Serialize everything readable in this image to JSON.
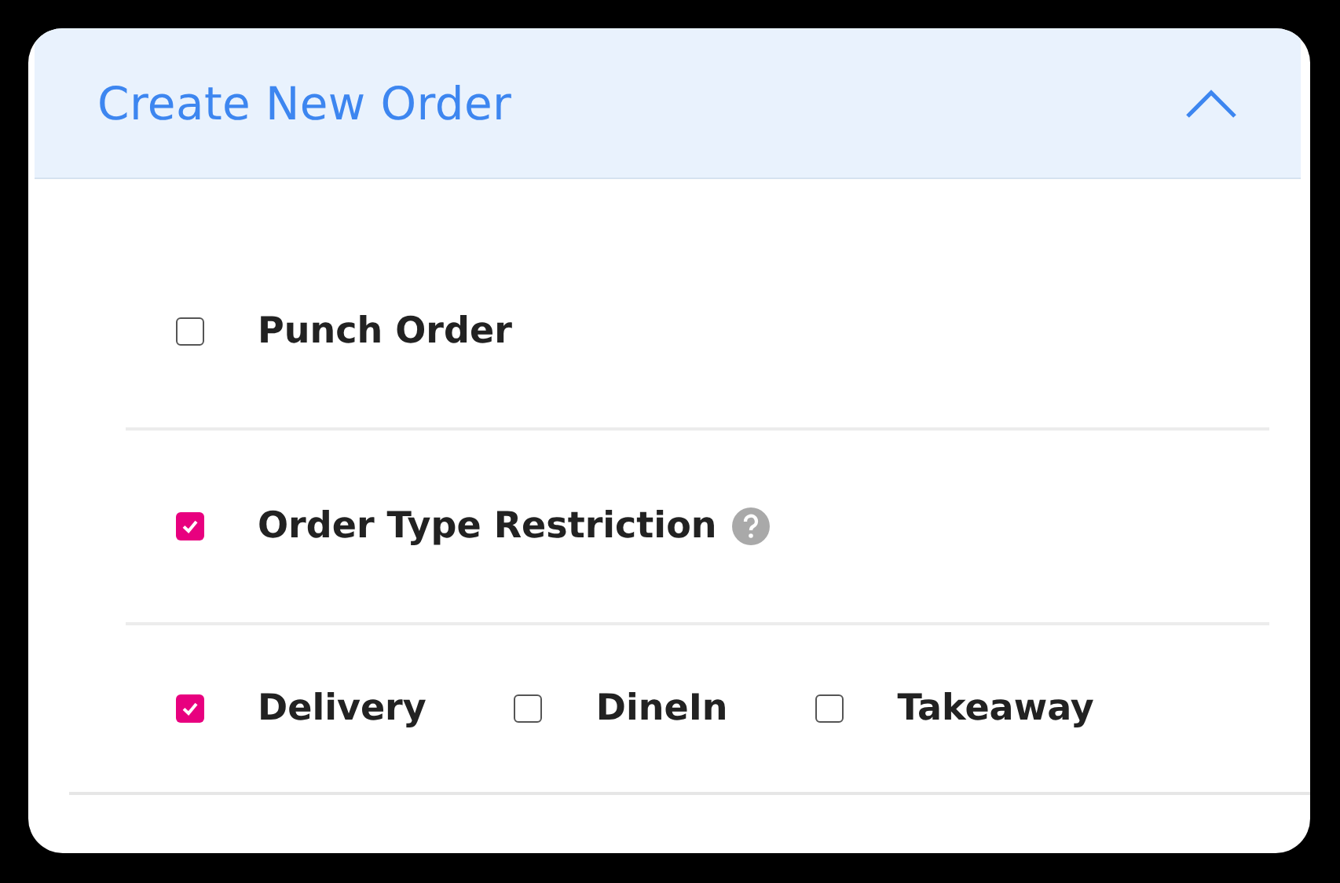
{
  "panel": {
    "title": "Create New Order",
    "expanded": true
  },
  "options": [
    {
      "label": "Punch Order",
      "checked": false,
      "help": false
    },
    {
      "label": "Order Type Restriction",
      "checked": true,
      "help": true
    }
  ],
  "order_types": [
    {
      "label": "Delivery",
      "checked": true
    },
    {
      "label": "DineIn",
      "checked": false
    },
    {
      "label": "Takeaway",
      "checked": false
    }
  ]
}
